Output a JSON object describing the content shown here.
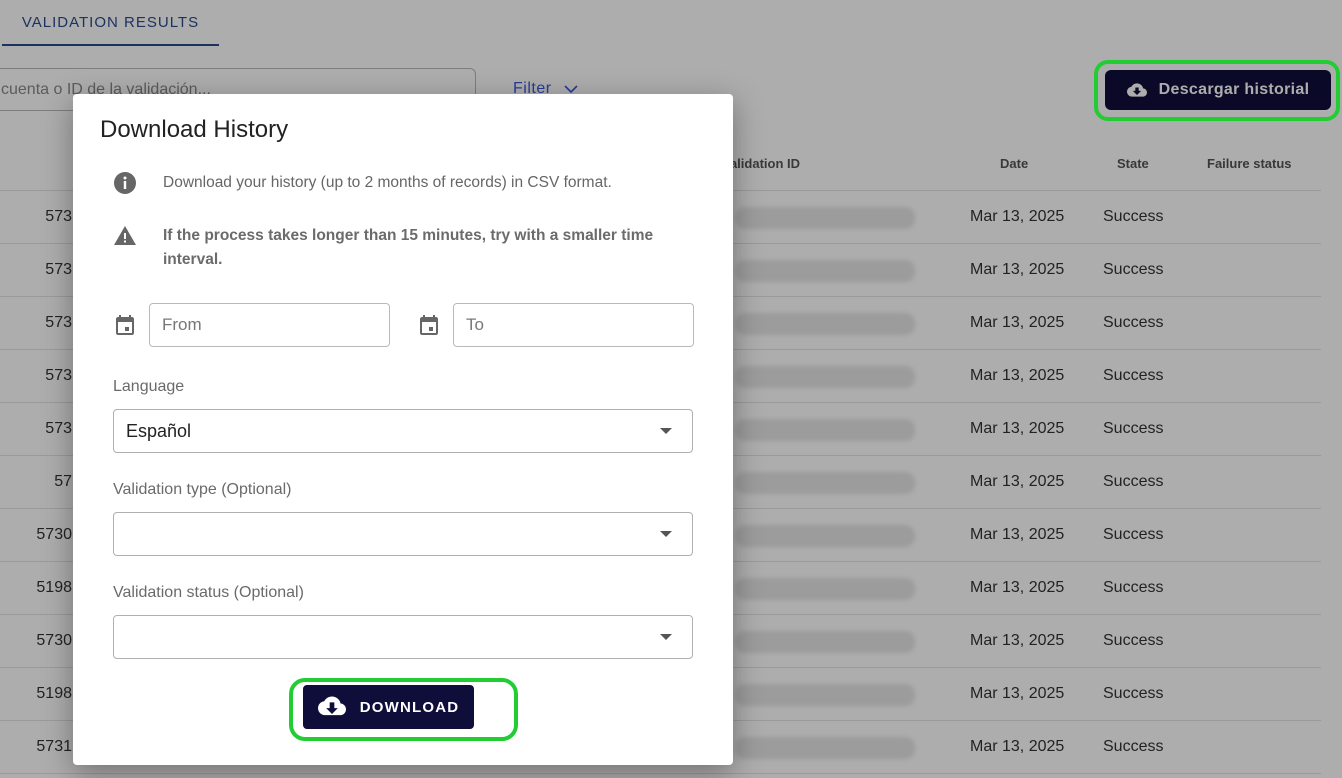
{
  "tab": {
    "label": "VALIDATION RESULTS"
  },
  "search": {
    "placeholder": "cuenta o ID de la validación..."
  },
  "filter": {
    "label": "Filter"
  },
  "history_button": {
    "label": "Descargar historial"
  },
  "table": {
    "headers": [
      "Validation ID",
      "Date",
      "State",
      "Failure status"
    ],
    "rows": [
      {
        "id": "573",
        "date": "Mar 13, 2025",
        "state": "Success"
      },
      {
        "id": "573",
        "date": "Mar 13, 2025",
        "state": "Success"
      },
      {
        "id": "573",
        "date": "Mar 13, 2025",
        "state": "Success"
      },
      {
        "id": "573",
        "date": "Mar 13, 2025",
        "state": "Success"
      },
      {
        "id": "573",
        "date": "Mar 13, 2025",
        "state": "Success"
      },
      {
        "id": "57",
        "date": "Mar 13, 2025",
        "state": "Success"
      },
      {
        "id": "5730",
        "date": "Mar 13, 2025",
        "state": "Success"
      },
      {
        "id": "5198",
        "date": "Mar 13, 2025",
        "state": "Success"
      },
      {
        "id": "5730",
        "date": "Mar 13, 2025",
        "state": "Success"
      },
      {
        "id": "5198",
        "date": "Mar 13, 2025",
        "state": "Success"
      },
      {
        "id": "5731",
        "date": "Mar 13, 2025",
        "state": "Success"
      }
    ]
  },
  "dialog": {
    "title": "Download History",
    "info_text": "Download your history (up to 2 months of records) in CSV format.",
    "warning_text": "If the process takes longer than 15 minutes, try with a smaller time interval.",
    "from_placeholder": "From",
    "to_placeholder": "To",
    "language_label": "Language",
    "language_value": "Español",
    "validation_type_label": "Validation type (Optional)",
    "validation_type_value": "",
    "validation_status_label": "Validation status (Optional)",
    "validation_status_value": "",
    "download_label": "DOWNLOAD"
  },
  "colors": {
    "primary": "#0f0e3a",
    "highlight": "#22cc33",
    "tab_accent": "#2a4b8d"
  }
}
